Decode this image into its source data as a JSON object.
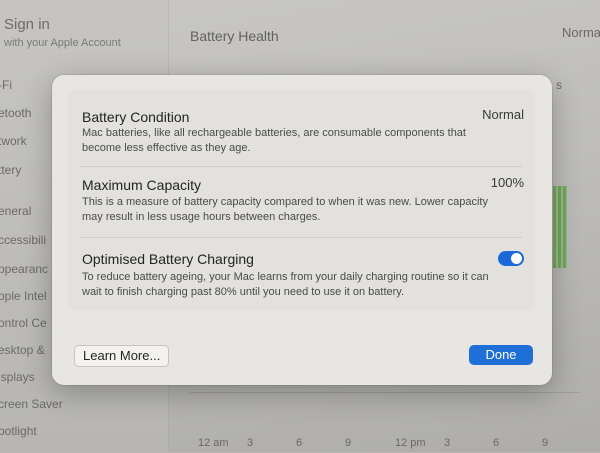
{
  "background": {
    "sidebar": {
      "signin_title": "Sign in",
      "signin_subtitle": "with your Apple Account",
      "items": [
        {
          "label": "-Fi"
        },
        {
          "label": "etooth"
        },
        {
          "label": "twork"
        },
        {
          "label": "ttery"
        },
        {
          "label": "eneral"
        },
        {
          "label": "ccessibili"
        },
        {
          "label": "ppearanc"
        },
        {
          "label": "pple Intel"
        },
        {
          "label": "ontrol Ce"
        },
        {
          "label": "esktop &"
        },
        {
          "label": "isplays"
        },
        {
          "label": "creen Saver"
        },
        {
          "label": "potlight"
        }
      ]
    },
    "header": {
      "title": "Battery Health",
      "right_value": "Norma",
      "right_small": "s"
    },
    "chart_axis": {
      "ticks": [
        "12 am",
        "3",
        "6",
        "9",
        "12 pm",
        "3",
        "6",
        "9"
      ]
    }
  },
  "dialog": {
    "battery_condition": {
      "title": "Battery Condition",
      "value": "Normal",
      "description": "Mac batteries, like all rechargeable batteries, are consumable components that become less effective as they age."
    },
    "maximum_capacity": {
      "title": "Maximum Capacity",
      "value": "100%",
      "description": "This is a measure of battery capacity compared to when it was new. Lower capacity may result in less usage hours between charges."
    },
    "optimised_charging": {
      "title": "Optimised Battery Charging",
      "enabled": true,
      "description": "To reduce battery ageing, your Mac learns from your daily charging routine so it can wait to finish charging past 80% until you need to use it on battery."
    },
    "buttons": {
      "learn_more": "Learn More...",
      "done": "Done"
    }
  },
  "colors": {
    "accent": "#1f6fd9",
    "toggle_on": "#1c68d8"
  }
}
